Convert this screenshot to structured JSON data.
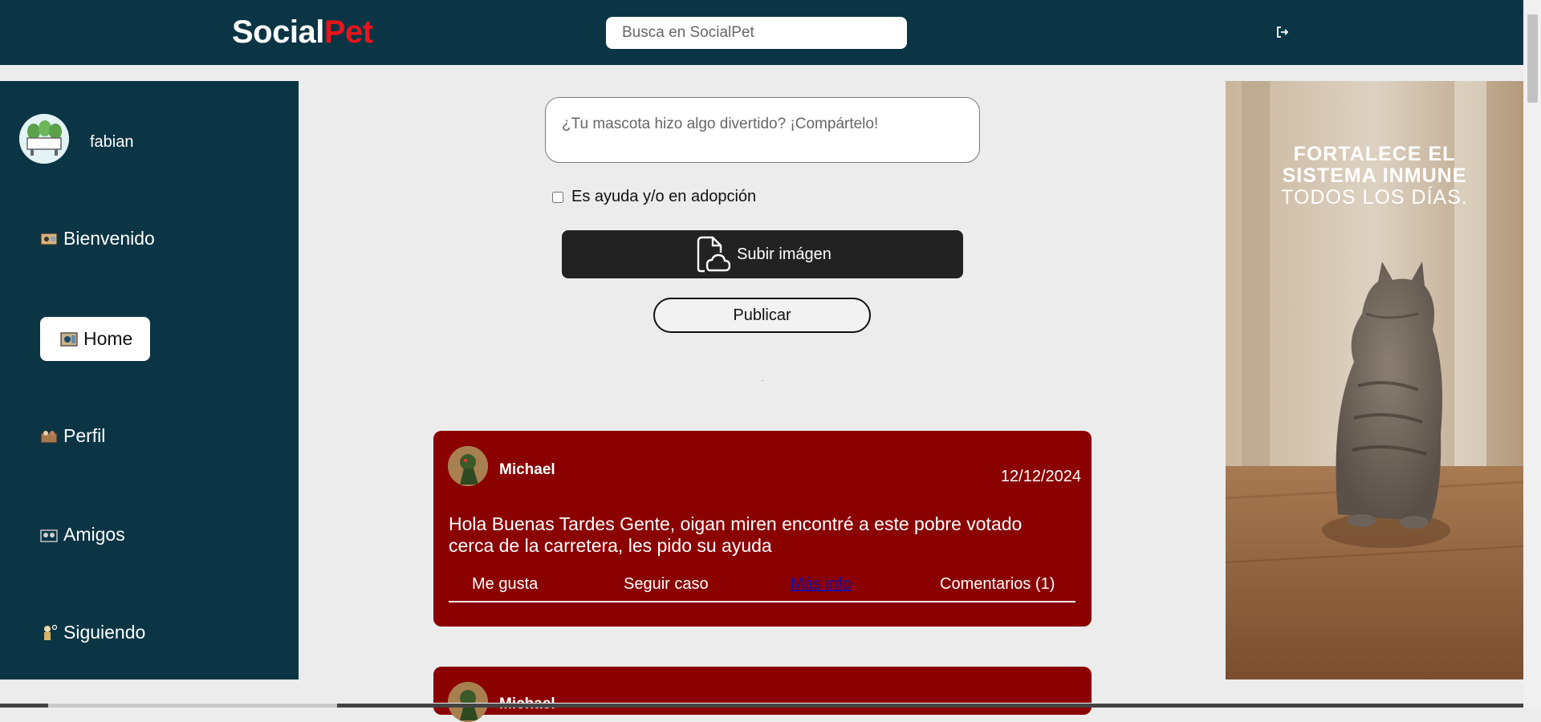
{
  "header": {
    "logo_part1": "Social",
    "logo_part2": "Pet",
    "search_placeholder": "Busca en SocialPet",
    "logout_icon": "logout-icon"
  },
  "sidebar": {
    "username": "fabian",
    "items": [
      {
        "label": "Bienvenido",
        "icon": "welcome-icon",
        "active": false
      },
      {
        "label": "Home",
        "icon": "home-icon",
        "active": true
      },
      {
        "label": "Perfil",
        "icon": "profile-icon",
        "active": false
      },
      {
        "label": "Amigos",
        "icon": "friends-icon",
        "active": false
      },
      {
        "label": "Siguiendo",
        "icon": "following-icon",
        "active": false
      }
    ]
  },
  "composer": {
    "placeholder": "¿Tu mascota hizo algo divertido? ¡Compártelo!",
    "checkbox_label": "Es ayuda y/o en adopción",
    "upload_label": "Subir imágen",
    "publish_label": "Publicar"
  },
  "posts": [
    {
      "author": "Michael",
      "date": "12/12/2024",
      "text": "Hola Buenas Tardes Gente, oigan miren encontré a este pobre votado cerca de la carretera, les pido su ayuda",
      "actions": {
        "like": "Me gusta",
        "follow": "Seguir caso",
        "more": "Más info",
        "comments": "Comentarios (1)"
      }
    },
    {
      "author": "Michael"
    }
  ],
  "ad": {
    "line1": "FORTALECE EL",
    "line2": "SISTEMA INMUNE",
    "line3": "TODOS LOS DÍAS."
  },
  "colors": {
    "header_bg": "#0b3544",
    "post_bg": "#8b0000",
    "logo_accent": "#e8141c",
    "page_bg": "#ececec"
  }
}
